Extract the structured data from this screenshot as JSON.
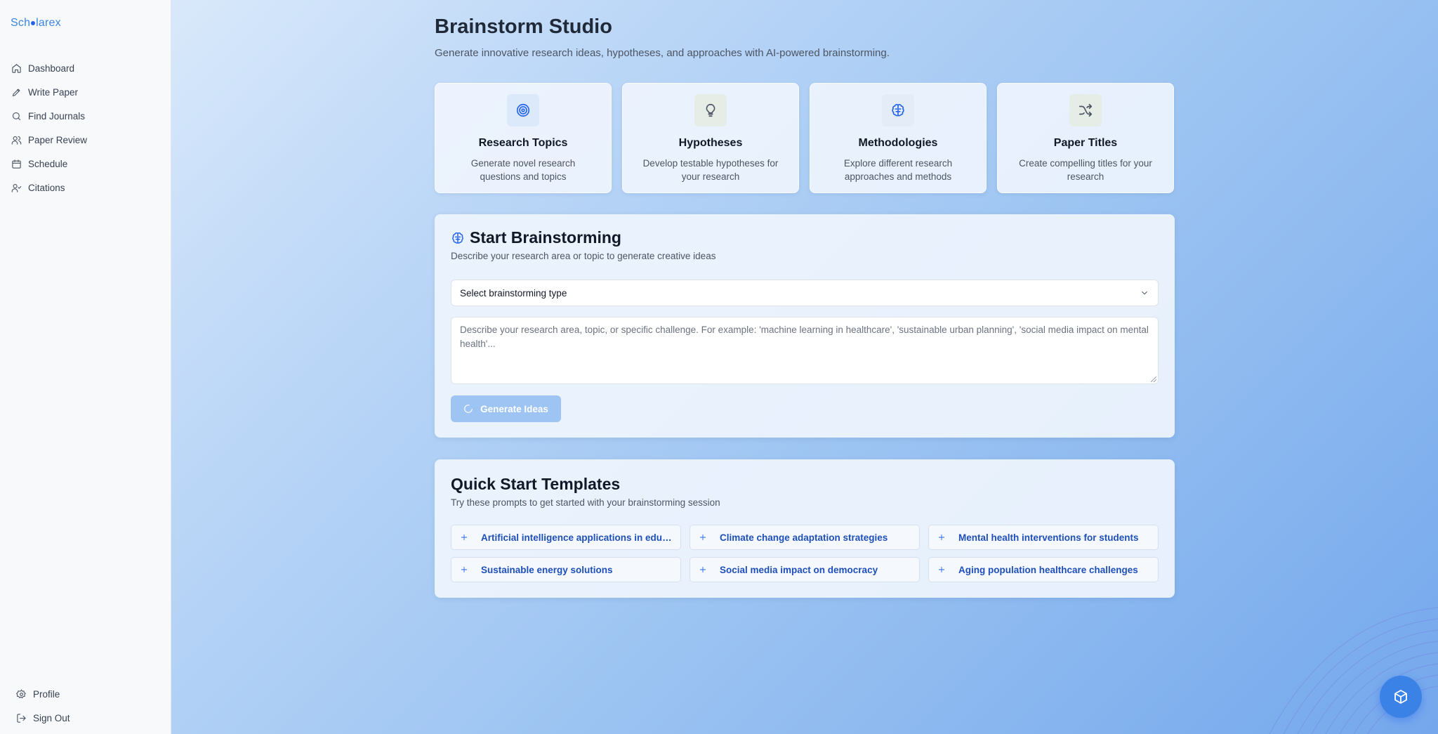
{
  "app": {
    "logo": {
      "prefix": "Sch",
      "suffix": "larex"
    }
  },
  "sidebar": {
    "items": [
      {
        "label": "Dashboard",
        "icon": "home-icon"
      },
      {
        "label": "Write Paper",
        "icon": "pen-icon"
      },
      {
        "label": "Find Journals",
        "icon": "search-icon"
      },
      {
        "label": "Paper Review",
        "icon": "users-icon"
      },
      {
        "label": "Schedule",
        "icon": "calendar-icon"
      },
      {
        "label": "Citations",
        "icon": "user-check-icon"
      }
    ],
    "bottom": [
      {
        "label": "Profile",
        "icon": "gear-icon"
      },
      {
        "label": "Sign Out",
        "icon": "logout-icon"
      }
    ]
  },
  "header": {
    "title": "Brainstorm Studio",
    "subtitle": "Generate innovative research ideas, hypotheses, and approaches with AI-powered brainstorming."
  },
  "features": [
    {
      "title": "Research Topics",
      "description": "Generate novel research questions and topics",
      "icon": "target-icon",
      "color": "#2563eb",
      "bg": "#dbe9fb"
    },
    {
      "title": "Hypotheses",
      "description": "Develop testable hypotheses for your research",
      "icon": "lightbulb-icon",
      "color": "#4b5563",
      "bg": "#e6ede6"
    },
    {
      "title": "Methodologies",
      "description": "Explore different research approaches and methods",
      "icon": "brain-icon",
      "color": "#2563eb",
      "bg": "#e4ecf8"
    },
    {
      "title": "Paper Titles",
      "description": "Create compelling titles for your research",
      "icon": "shuffle-icon",
      "color": "#4b5563",
      "bg": "#e6ede6"
    }
  ],
  "brainstorm": {
    "title": "Start Brainstorming",
    "subtitle": "Describe your research area or topic to generate creative ideas",
    "select_value": "Select brainstorming type",
    "textarea_placeholder": "Describe your research area, topic, or specific challenge. For example: 'machine learning in healthcare', 'sustainable urban planning', 'social media impact on mental health'...",
    "generate_label": "Generate Ideas"
  },
  "templates": {
    "title": "Quick Start Templates",
    "subtitle": "Try these prompts to get started with your brainstorming session",
    "items": [
      "Artificial intelligence applications in educ...",
      "Climate change adaptation strategies",
      "Mental health interventions for students",
      "Sustainable energy solutions",
      "Social media impact on democracy",
      "Aging population healthcare challenges"
    ]
  },
  "colors": {
    "accent": "#2563eb",
    "button_disabled": "#9dc4f3",
    "template_text": "#1e4fb8"
  }
}
